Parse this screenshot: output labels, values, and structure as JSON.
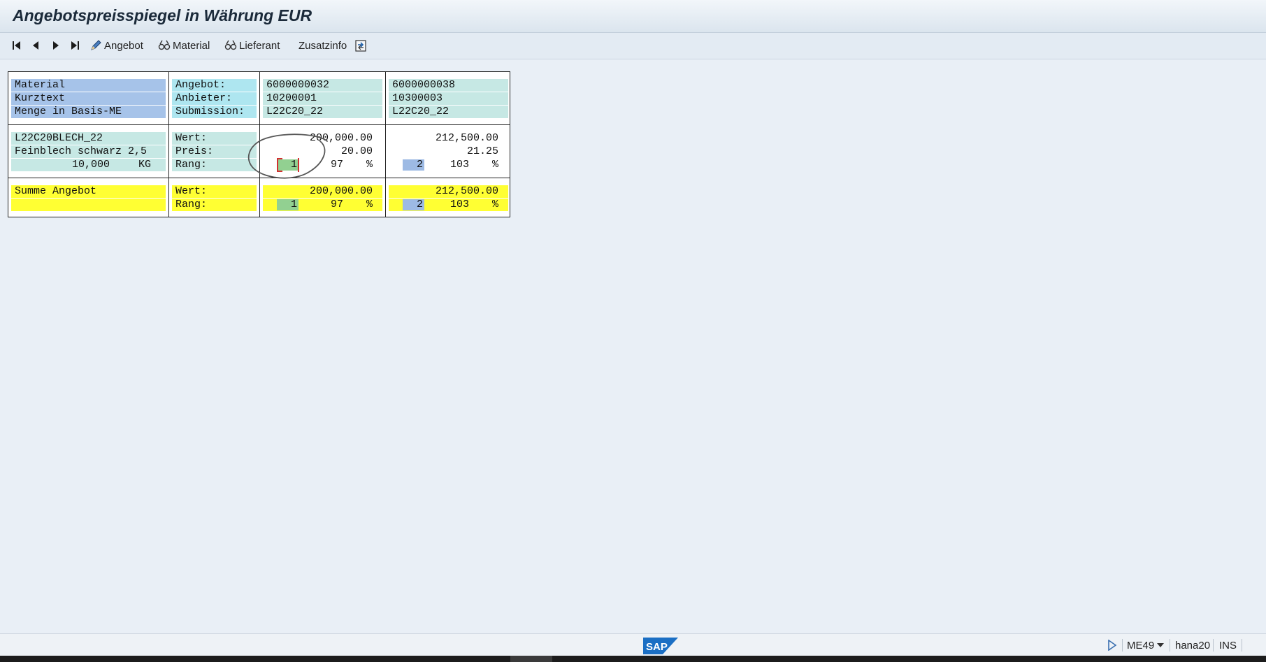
{
  "window": {
    "title": "Angebotspreisspiegel in Währung EUR"
  },
  "toolbar": {
    "angebot_label": "Angebot",
    "material_label": "Material",
    "lieferant_label": "Lieferant",
    "zusatzinfo_label": "Zusatzinfo",
    "icons": [
      "first-page-icon",
      "previous-page-icon",
      "next-page-icon",
      "last-page-icon",
      "pencil-icon",
      "glasses-icon",
      "glasses-icon",
      "export-icon"
    ]
  },
  "header": {
    "left": [
      "Material",
      "Kurztext",
      "Menge in Basis-ME"
    ],
    "mid": [
      "Angebot:",
      "Anbieter:",
      "Submission:"
    ],
    "quotes": [
      {
        "angebot": "6000000032",
        "anbieter": "10200001",
        "submission": "L22C20_22"
      },
      {
        "angebot": "6000000038",
        "anbieter": "10300003",
        "submission": "L22C20_22"
      }
    ]
  },
  "item": {
    "material": "L22C20BLECH_22",
    "kurztext": "Feinblech schwarz 2,5",
    "menge": "10,000",
    "unit": "KG",
    "labels": [
      "Wert:",
      "Preis:",
      "Rang:"
    ],
    "quotes": [
      {
        "wert": "200,000.00",
        "preis": "20.00",
        "rang": "1",
        "pct": "97",
        "pct_sign": "%"
      },
      {
        "wert": "212,500.00",
        "preis": "21.25",
        "rang": "2",
        "pct": "103",
        "pct_sign": "%"
      }
    ]
  },
  "summary": {
    "label": "Summe Angebot",
    "labels": [
      "Wert:",
      "Rang:"
    ],
    "quotes": [
      {
        "wert": "200,000.00",
        "rang": "1",
        "pct": "97",
        "pct_sign": "%"
      },
      {
        "wert": "212,500.00",
        "rang": "2",
        "pct": "103",
        "pct_sign": "%"
      }
    ]
  },
  "status": {
    "transaction": "ME49",
    "system": "hana20",
    "mode": "INS",
    "logo": "SAP"
  },
  "colors": {
    "header_blue": "#a6c3e9",
    "header_aqua": "#aee6f0",
    "row_teal": "#c6e8e4",
    "summary_yellow": "#ffff33",
    "rank_best": "#92d091",
    "rank_other": "#9dbae4",
    "sap_logo": "#1b6fc4"
  }
}
